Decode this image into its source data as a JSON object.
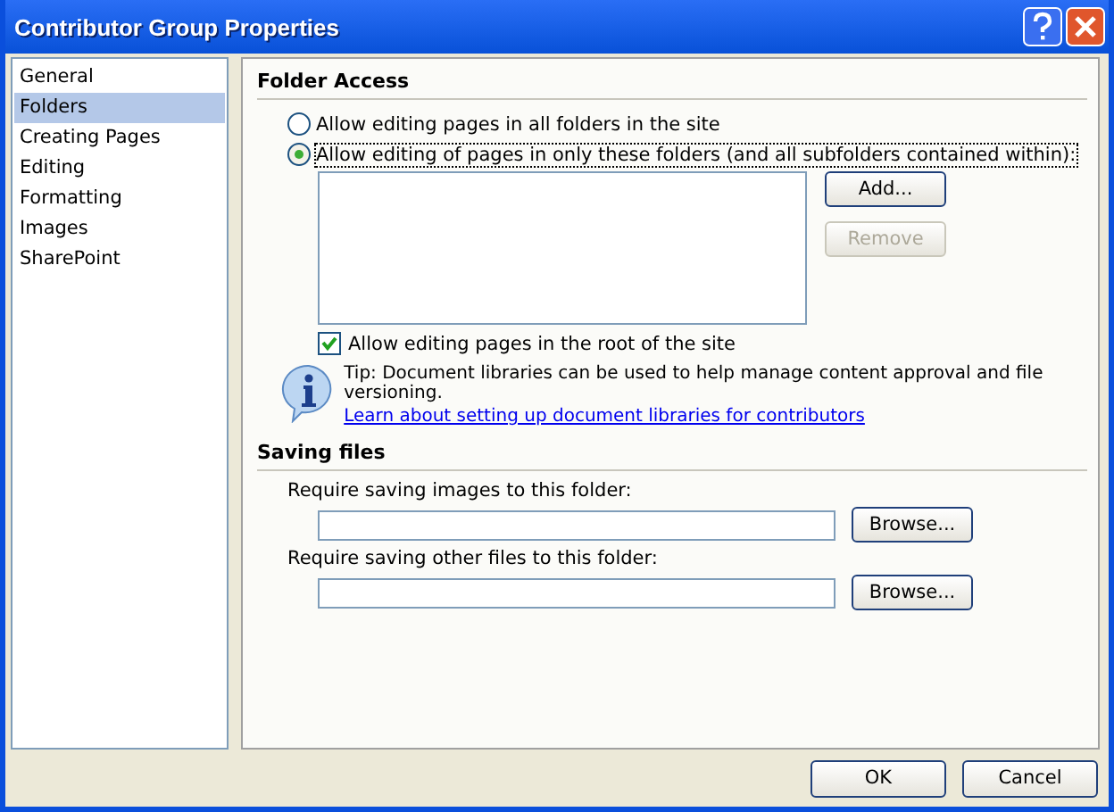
{
  "window": {
    "title": "Contributor Group Properties"
  },
  "sidebar": {
    "items": [
      {
        "label": "General",
        "selected": false
      },
      {
        "label": "Folders",
        "selected": true
      },
      {
        "label": "Creating Pages",
        "selected": false
      },
      {
        "label": "Editing",
        "selected": false
      },
      {
        "label": "Formatting",
        "selected": false
      },
      {
        "label": "Images",
        "selected": false
      },
      {
        "label": "SharePoint",
        "selected": false
      }
    ]
  },
  "folder_access": {
    "heading": "Folder Access",
    "options": [
      {
        "label": "Allow editing pages in all folders in the site",
        "selected": false
      },
      {
        "label": "Allow editing of pages in only these folders (and all subfolders contained within):",
        "selected": true
      }
    ],
    "add_button": {
      "label": "Add...",
      "disabled": false
    },
    "remove_button": {
      "label": "Remove",
      "disabled": true
    },
    "root_checkbox": {
      "label": "Allow editing pages in the root of the site",
      "checked": true
    },
    "tip": "Tip: Document libraries can be used to help manage content approval and file versioning.",
    "link": "Learn about setting up document libraries for contributors"
  },
  "saving_files": {
    "heading": "Saving files",
    "fields": [
      {
        "label": "Require saving images to this folder:",
        "button": "Browse..."
      },
      {
        "label": "Require saving other files to this folder:",
        "button": "Browse..."
      }
    ]
  },
  "buttons": [
    "OK",
    "Cancel"
  ]
}
